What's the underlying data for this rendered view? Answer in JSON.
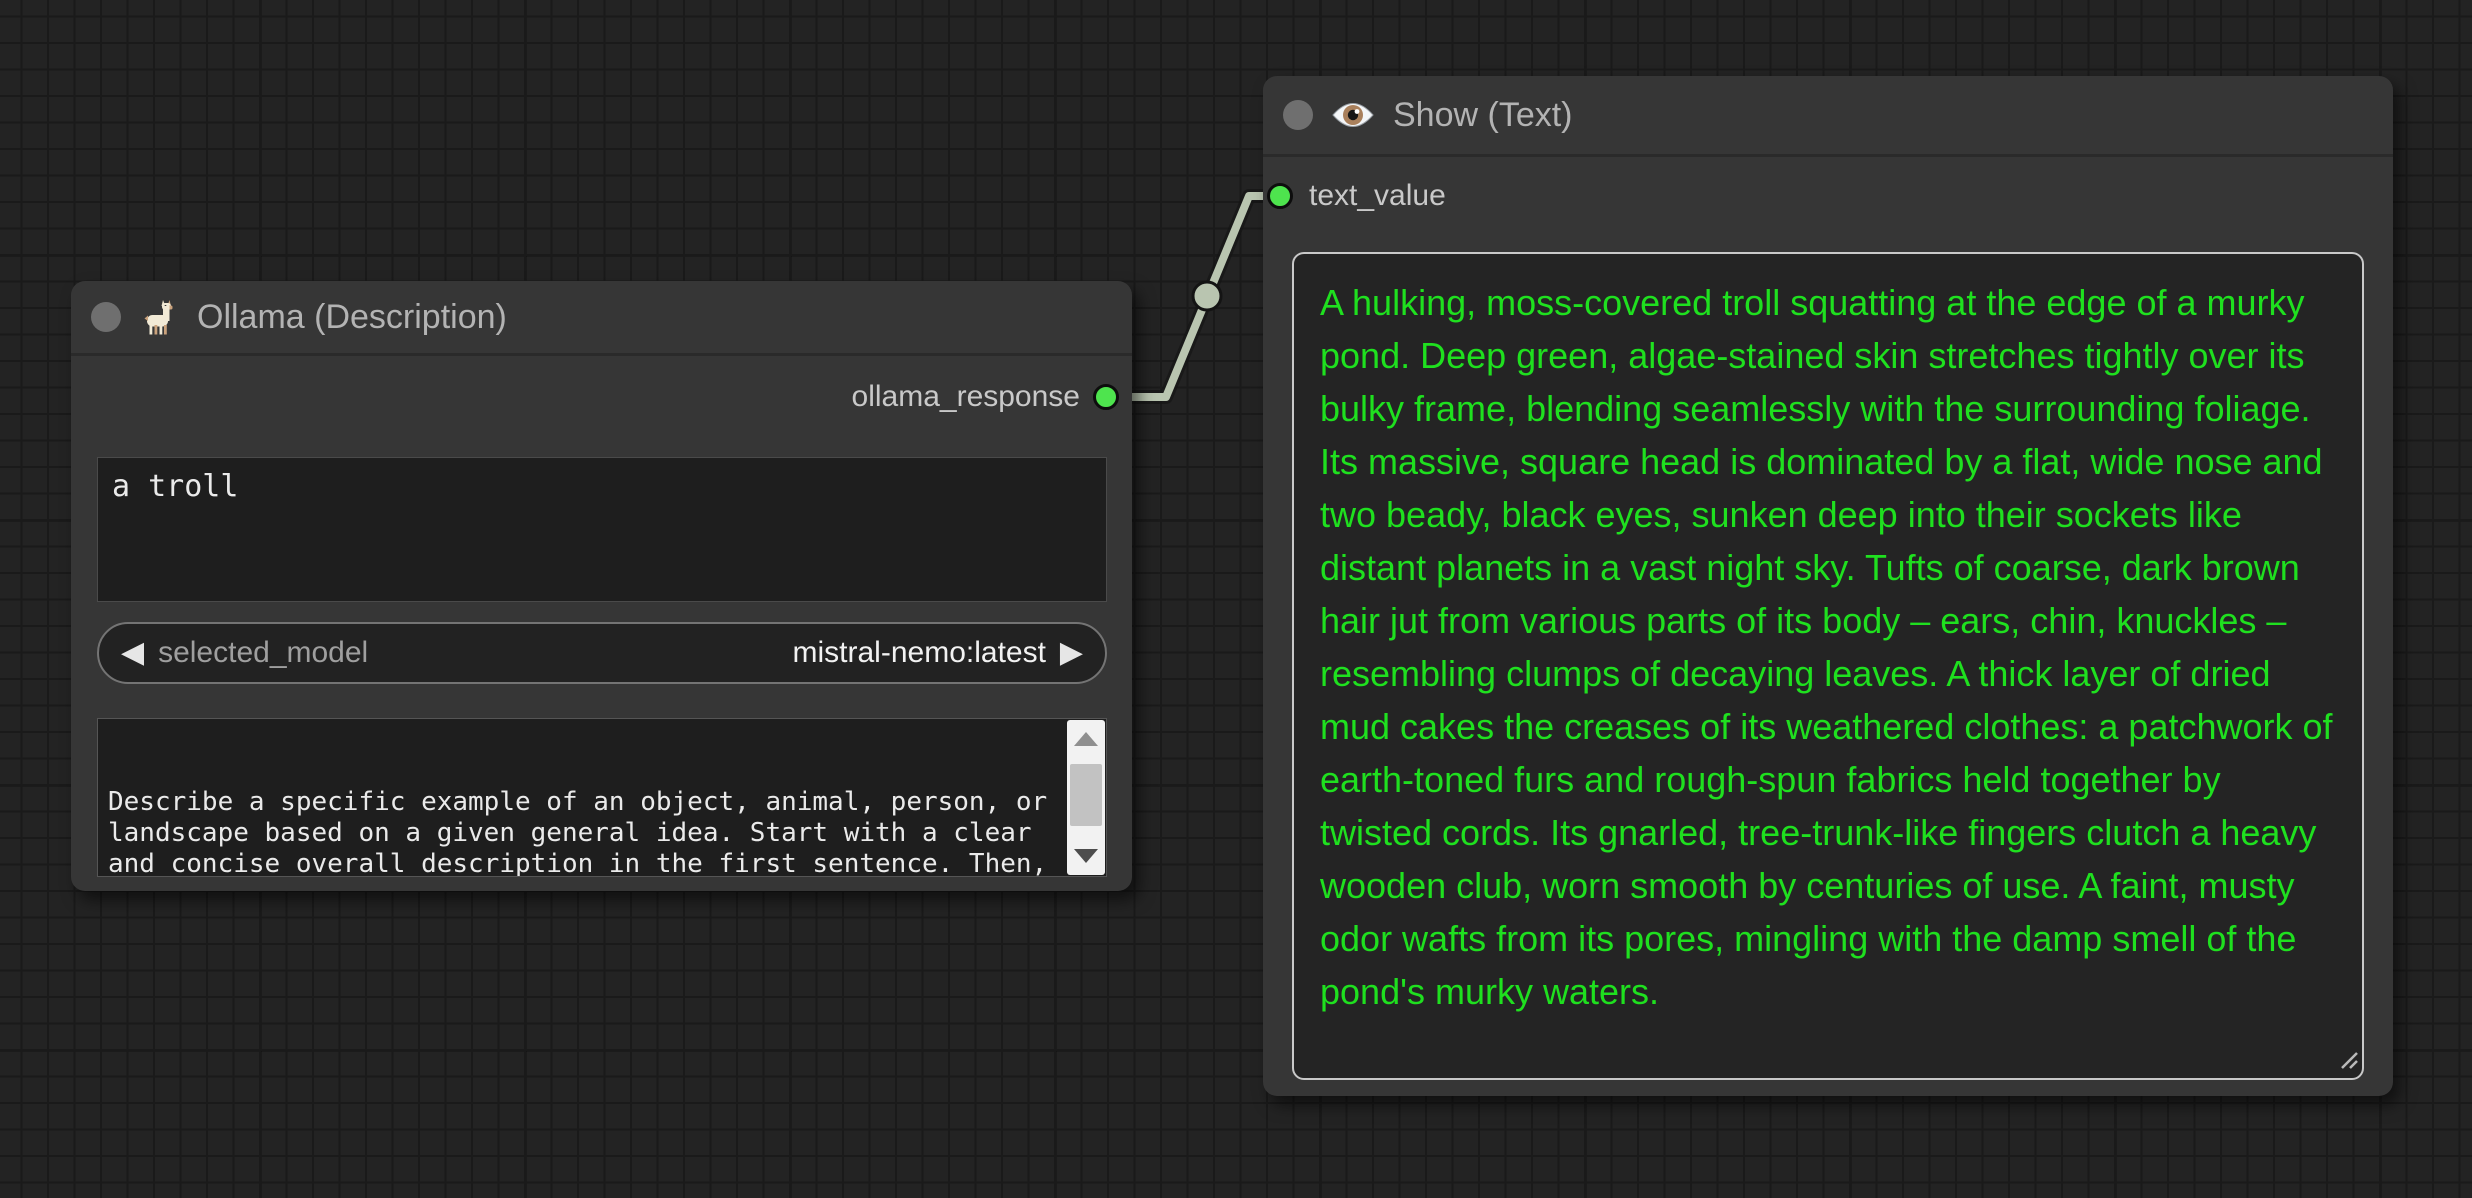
{
  "colors": {
    "slot_green": "#4ee44e",
    "link": "#b9c5b0",
    "display_text_green": "#1fe01f",
    "node_bg": "#363636",
    "canvas_bg": "#232323"
  },
  "link": {
    "from": "ollama_response",
    "to": "text_value"
  },
  "nodes": {
    "ollama": {
      "title": "Ollama (Description)",
      "icon": "llama-icon",
      "output_label": "ollama_response",
      "text_input_value": "a troll",
      "model_widget": {
        "left_arrow": "◀",
        "label": "selected_model",
        "value": "mistral-nemo:latest",
        "right_arrow": "▶"
      },
      "prompt_value": "Describe a specific example of an object, animal, person, or\nlandscape based on a given general idea. Start with a clear\nand concise overall description in the first sentence. Then,\nprovide a detailed depiction of its physical features,\nfocusing on colors, size, clothing, eyes, and other"
    },
    "show_text": {
      "title": "Show (Text)",
      "icon": "eye-icon",
      "input_label": "text_value",
      "display_value": "A hulking, moss-covered troll squatting at the edge of a murky pond. Deep green, algae-stained skin stretches tightly over its bulky frame, blending seamlessly with the surrounding foliage. Its massive, square head is dominated by a flat, wide nose and two beady, black eyes, sunken deep into their sockets like distant planets in a vast night sky. Tufts of coarse, dark brown hair jut from various parts of its body – ears, chin, knuckles – resembling clumps of decaying leaves. A thick layer of dried mud cakes the creases of its weathered clothes: a patchwork of earth-toned furs and rough-spun fabrics held together by twisted cords. Its gnarled, tree-trunk-like fingers clutch a heavy wooden club, worn smooth by centuries of use. A faint, musty odor wafts from its pores, mingling with the damp smell of the pond's murky waters."
    }
  }
}
